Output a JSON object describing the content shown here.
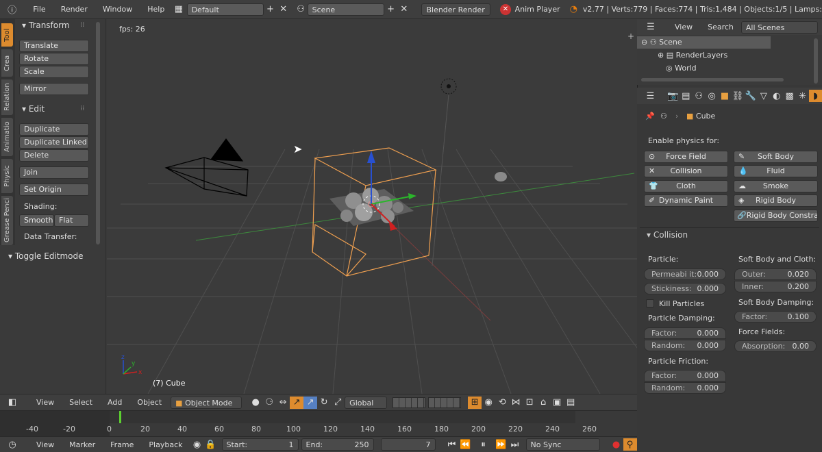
{
  "topbar": {
    "menus": [
      "File",
      "Render",
      "Window",
      "Help"
    ],
    "layout": "Default",
    "scene": "Scene",
    "engine": "Blender Render",
    "anim_player": "Anim Player",
    "stats": "v2.77 | Verts:779 | Faces:774 | Tris:1,484 | Objects:1/5 | Lamps:"
  },
  "toolshelf": {
    "tabs": [
      "Tool",
      "Crea",
      "Relation",
      "Animatio",
      "Physic",
      "Grease Penci"
    ],
    "transform_header": "Transform",
    "translate": "Translate",
    "rotate": "Rotate",
    "scale": "Scale",
    "mirror": "Mirror",
    "edit_header": "Edit",
    "duplicate": "Duplicate",
    "duplicate_linked": "Duplicate Linked",
    "delete": "Delete",
    "join": "Join",
    "set_origin": "Set Origin",
    "shading_label": "Shading:",
    "smooth": "Smooth",
    "flat": "Flat",
    "data_transfer": "Data Transfer:",
    "toggle_editmode": "Toggle Editmode"
  },
  "viewport": {
    "fps": "fps: 26",
    "object_label": "(7) Cube"
  },
  "view3d_header": {
    "view": "View",
    "select": "Select",
    "add": "Add",
    "object": "Object",
    "mode": "Object Mode",
    "orientation": "Global"
  },
  "timeline": {
    "ticks": [
      "-40",
      "-20",
      "0",
      "20",
      "40",
      "60",
      "80",
      "100",
      "120",
      "140",
      "160",
      "180",
      "200",
      "220",
      "240",
      "260"
    ],
    "current_frame_marker": 7
  },
  "timeline_header": {
    "view": "View",
    "marker": "Marker",
    "frame": "Frame",
    "playback": "Playback",
    "start_label": "Start:",
    "start": "1",
    "end_label": "End:",
    "end": "250",
    "current": "7",
    "sync": "No Sync"
  },
  "outliner": {
    "view": "View",
    "search": "Search",
    "scenes_filter": "All Scenes",
    "scene": "Scene",
    "render_layers": "RenderLayers",
    "world": "World"
  },
  "properties": {
    "object": "Cube",
    "enable_physics_for": "Enable physics for:",
    "physics_buttons": [
      "Force Field",
      "Soft Body",
      "Collision",
      "Fluid",
      "Cloth",
      "Smoke",
      "Dynamic Paint",
      "Rigid Body",
      "Rigid Body Constrai..."
    ],
    "collision_header": "Collision",
    "particle": "Particle:",
    "permeability_label": "Permeabi it:",
    "permeability": "0.000",
    "stickiness_label": "Stickiness:",
    "stickiness": "0.000",
    "kill_particles": "Kill Particles",
    "particle_damping": "Particle Damping:",
    "factor_label": "Factor:",
    "random_label": "Random:",
    "damping_factor": "0.000",
    "damping_random": "0.000",
    "particle_friction": "Particle Friction:",
    "friction_factor": "0.000",
    "friction_random": "0.000",
    "soft_body_cloth": "Soft Body and Cloth:",
    "outer_label": "Outer:",
    "outer": "0.020",
    "inner_label": "Inner:",
    "inner": "0.200",
    "soft_body_damping": "Soft Body Damping:",
    "sb_factor": "0.100",
    "force_fields": "Force Fields:",
    "absorption_label": "Absorption:",
    "absorption": "0.00"
  },
  "colors": {
    "accent": "#dd8b2e",
    "selection": "#f0a050"
  }
}
